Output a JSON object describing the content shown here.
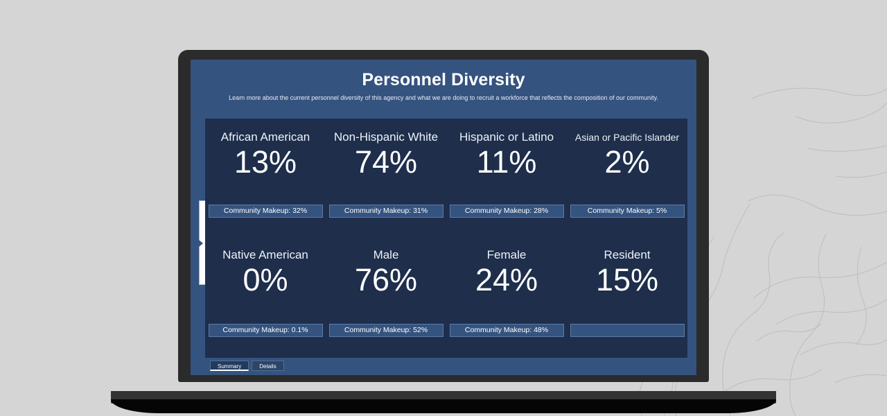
{
  "header": {
    "title": "Personnel Diversity",
    "subtitle": "Learn more about the current personnel diversity of this agency and what we are doing to recruit a workforce that reflects the composition of our community."
  },
  "dashboard": {
    "makeup_prefix": "Community Makeup: ",
    "stats": [
      {
        "label": "African American",
        "value": "13%",
        "makeup": "Community Makeup: 32%",
        "makeup_value": "32%",
        "label_size": "large"
      },
      {
        "label": "Non-Hispanic White",
        "value": "74%",
        "makeup": "Community Makeup: 31%",
        "makeup_value": "31%",
        "label_size": "large"
      },
      {
        "label": "Hispanic or Latino",
        "value": "11%",
        "makeup": "Community Makeup: 28%",
        "makeup_value": "28%",
        "label_size": "large"
      },
      {
        "label": "Asian or Pacific Islander",
        "value": "2%",
        "makeup": "Community Makeup: 5%",
        "makeup_value": "5%",
        "label_size": "small"
      },
      {
        "label": "Native American",
        "value": "0%",
        "makeup": "Community Makeup: 0.1%",
        "makeup_value": "0.1%",
        "label_size": "large"
      },
      {
        "label": "Male",
        "value": "76%",
        "makeup": "Community Makeup: 52%",
        "makeup_value": "52%",
        "label_size": "large"
      },
      {
        "label": "Female",
        "value": "24%",
        "makeup": "Community Makeup: 48%",
        "makeup_value": "48%",
        "label_size": "large"
      },
      {
        "label": "Resident",
        "value": "15%",
        "makeup": "",
        "makeup_value": "",
        "label_size": "large"
      }
    ]
  },
  "tabs": [
    {
      "label": "Summary",
      "active": true
    },
    {
      "label": "Details",
      "active": false
    }
  ],
  "drawer": {
    "icon": "chevron-right-icon"
  },
  "colors": {
    "page_background": "#d5d5d5",
    "topo_line": "#bdbdbd",
    "laptop_body": "#2b2b2b",
    "screen_background": "#35537f",
    "panel_background": "#1e2e4b",
    "chip_background": "#35537f",
    "chip_border": "#5d7ba6",
    "text_primary": "#ffffff"
  }
}
